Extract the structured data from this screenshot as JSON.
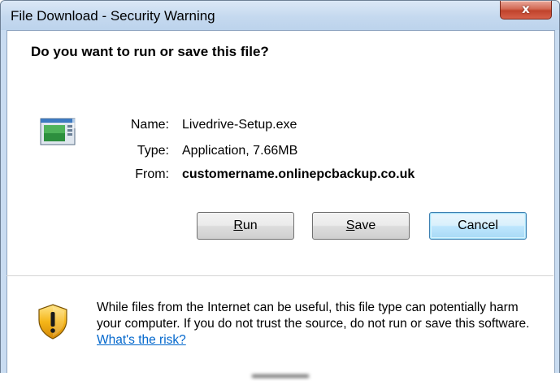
{
  "window": {
    "title": "File Download - Security Warning",
    "close_glyph": "x"
  },
  "dialog": {
    "question": "Do you want to run or save this file?",
    "file_icon": "application-icon",
    "fields": {
      "name_label": "Name:",
      "name_value": "Livedrive-Setup.exe",
      "type_label": "Type:",
      "type_value": "Application, 7.66MB",
      "from_label": "From:",
      "from_value": "customername.onlinepcbackup.co.uk"
    },
    "buttons": {
      "run_mnemonic": "R",
      "run_rest": "un",
      "save_mnemonic": "S",
      "save_rest": "ave",
      "cancel": "Cancel"
    },
    "warning": {
      "icon": "shield-warning-icon",
      "text": "While files from the Internet can be useful, this file type can potentially harm your computer. If you do not trust the source, do not run or save this software. ",
      "link": "What's the risk?"
    }
  },
  "colors": {
    "title_bar": "#c5d9ef",
    "close_button": "#c0432c",
    "link": "#0066cc",
    "default_button_border": "#3c7fb1"
  }
}
